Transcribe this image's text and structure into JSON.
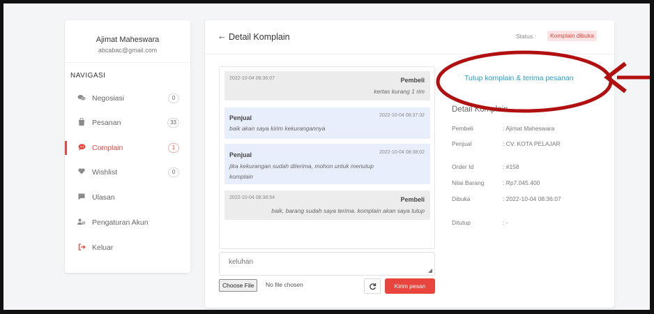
{
  "user": {
    "name": "Ajimat Maheswara",
    "email": "abcabac@gmail.com"
  },
  "nav": {
    "title": "NAVIGASI",
    "items": [
      {
        "label": "Negosiasi",
        "badge": "0",
        "icon": "chat-bubbles-icon"
      },
      {
        "label": "Pesanan",
        "badge": "33",
        "icon": "shopping-bag-icon"
      },
      {
        "label": "Complain",
        "badge": "1",
        "icon": "comment-icon",
        "active": true
      },
      {
        "label": "Wishlist",
        "badge": "0",
        "icon": "heart-icon"
      },
      {
        "label": "Ulasan",
        "icon": "message-square-icon"
      },
      {
        "label": "Pengaturan Akun",
        "icon": "users-gear-icon"
      },
      {
        "label": "Keluar",
        "icon": "logout-icon"
      }
    ]
  },
  "header": {
    "back_arrow": "←",
    "title": "Detail Komplain",
    "status_label": "Status :",
    "status_value": "Komplain dibuka"
  },
  "chat": {
    "messages": [
      {
        "sender": "Pembeli",
        "timestamp": "2022-10-04 08:36:07",
        "text": "kertas kurang 1 rim"
      },
      {
        "sender": "Penjual",
        "timestamp": "2022-10-04 08:37:32",
        "text": "baik akan saya kirim kekurangannya"
      },
      {
        "sender": "Penjual",
        "timestamp": "2022-10-04 08:38:02",
        "text_line1": "jika kekurangan sudah diterima, mohon untuk menutup",
        "text_line2": "komplain"
      },
      {
        "sender": "Pembeli",
        "timestamp": "2022-10-04 08:38:54",
        "text": "baik, barang sudah saya terima. komplain akan saya tutup"
      }
    ],
    "input_placeholder": "keluhan",
    "choose_file_label": "Choose File",
    "no_file_text": "No file chosen",
    "send_label": "Kirim pesan"
  },
  "detail": {
    "close_link": "Tutup komplain & terima pesanan",
    "title": "Detail Komplain",
    "fields": [
      {
        "label": "Pembeli",
        "value": ": Ajimat Maheswara"
      },
      {
        "label": "Penjual",
        "value": ": CV. KOTA PELAJAR"
      },
      {
        "label": "Order Id",
        "value": ": #158"
      },
      {
        "label": "Nilai Barang",
        "value": ": Rp7.045.400"
      },
      {
        "label": "Dibuka",
        "value": ": 2022-10-04 08:36:07"
      },
      {
        "label": "Ditutup",
        "value": ": -"
      }
    ]
  },
  "colors": {
    "accent": "#e8453c",
    "link": "#2a9ec9",
    "annotation": "#b01010",
    "seller_bubble": "#e8eefb",
    "buyer_bubble": "#ececec"
  }
}
